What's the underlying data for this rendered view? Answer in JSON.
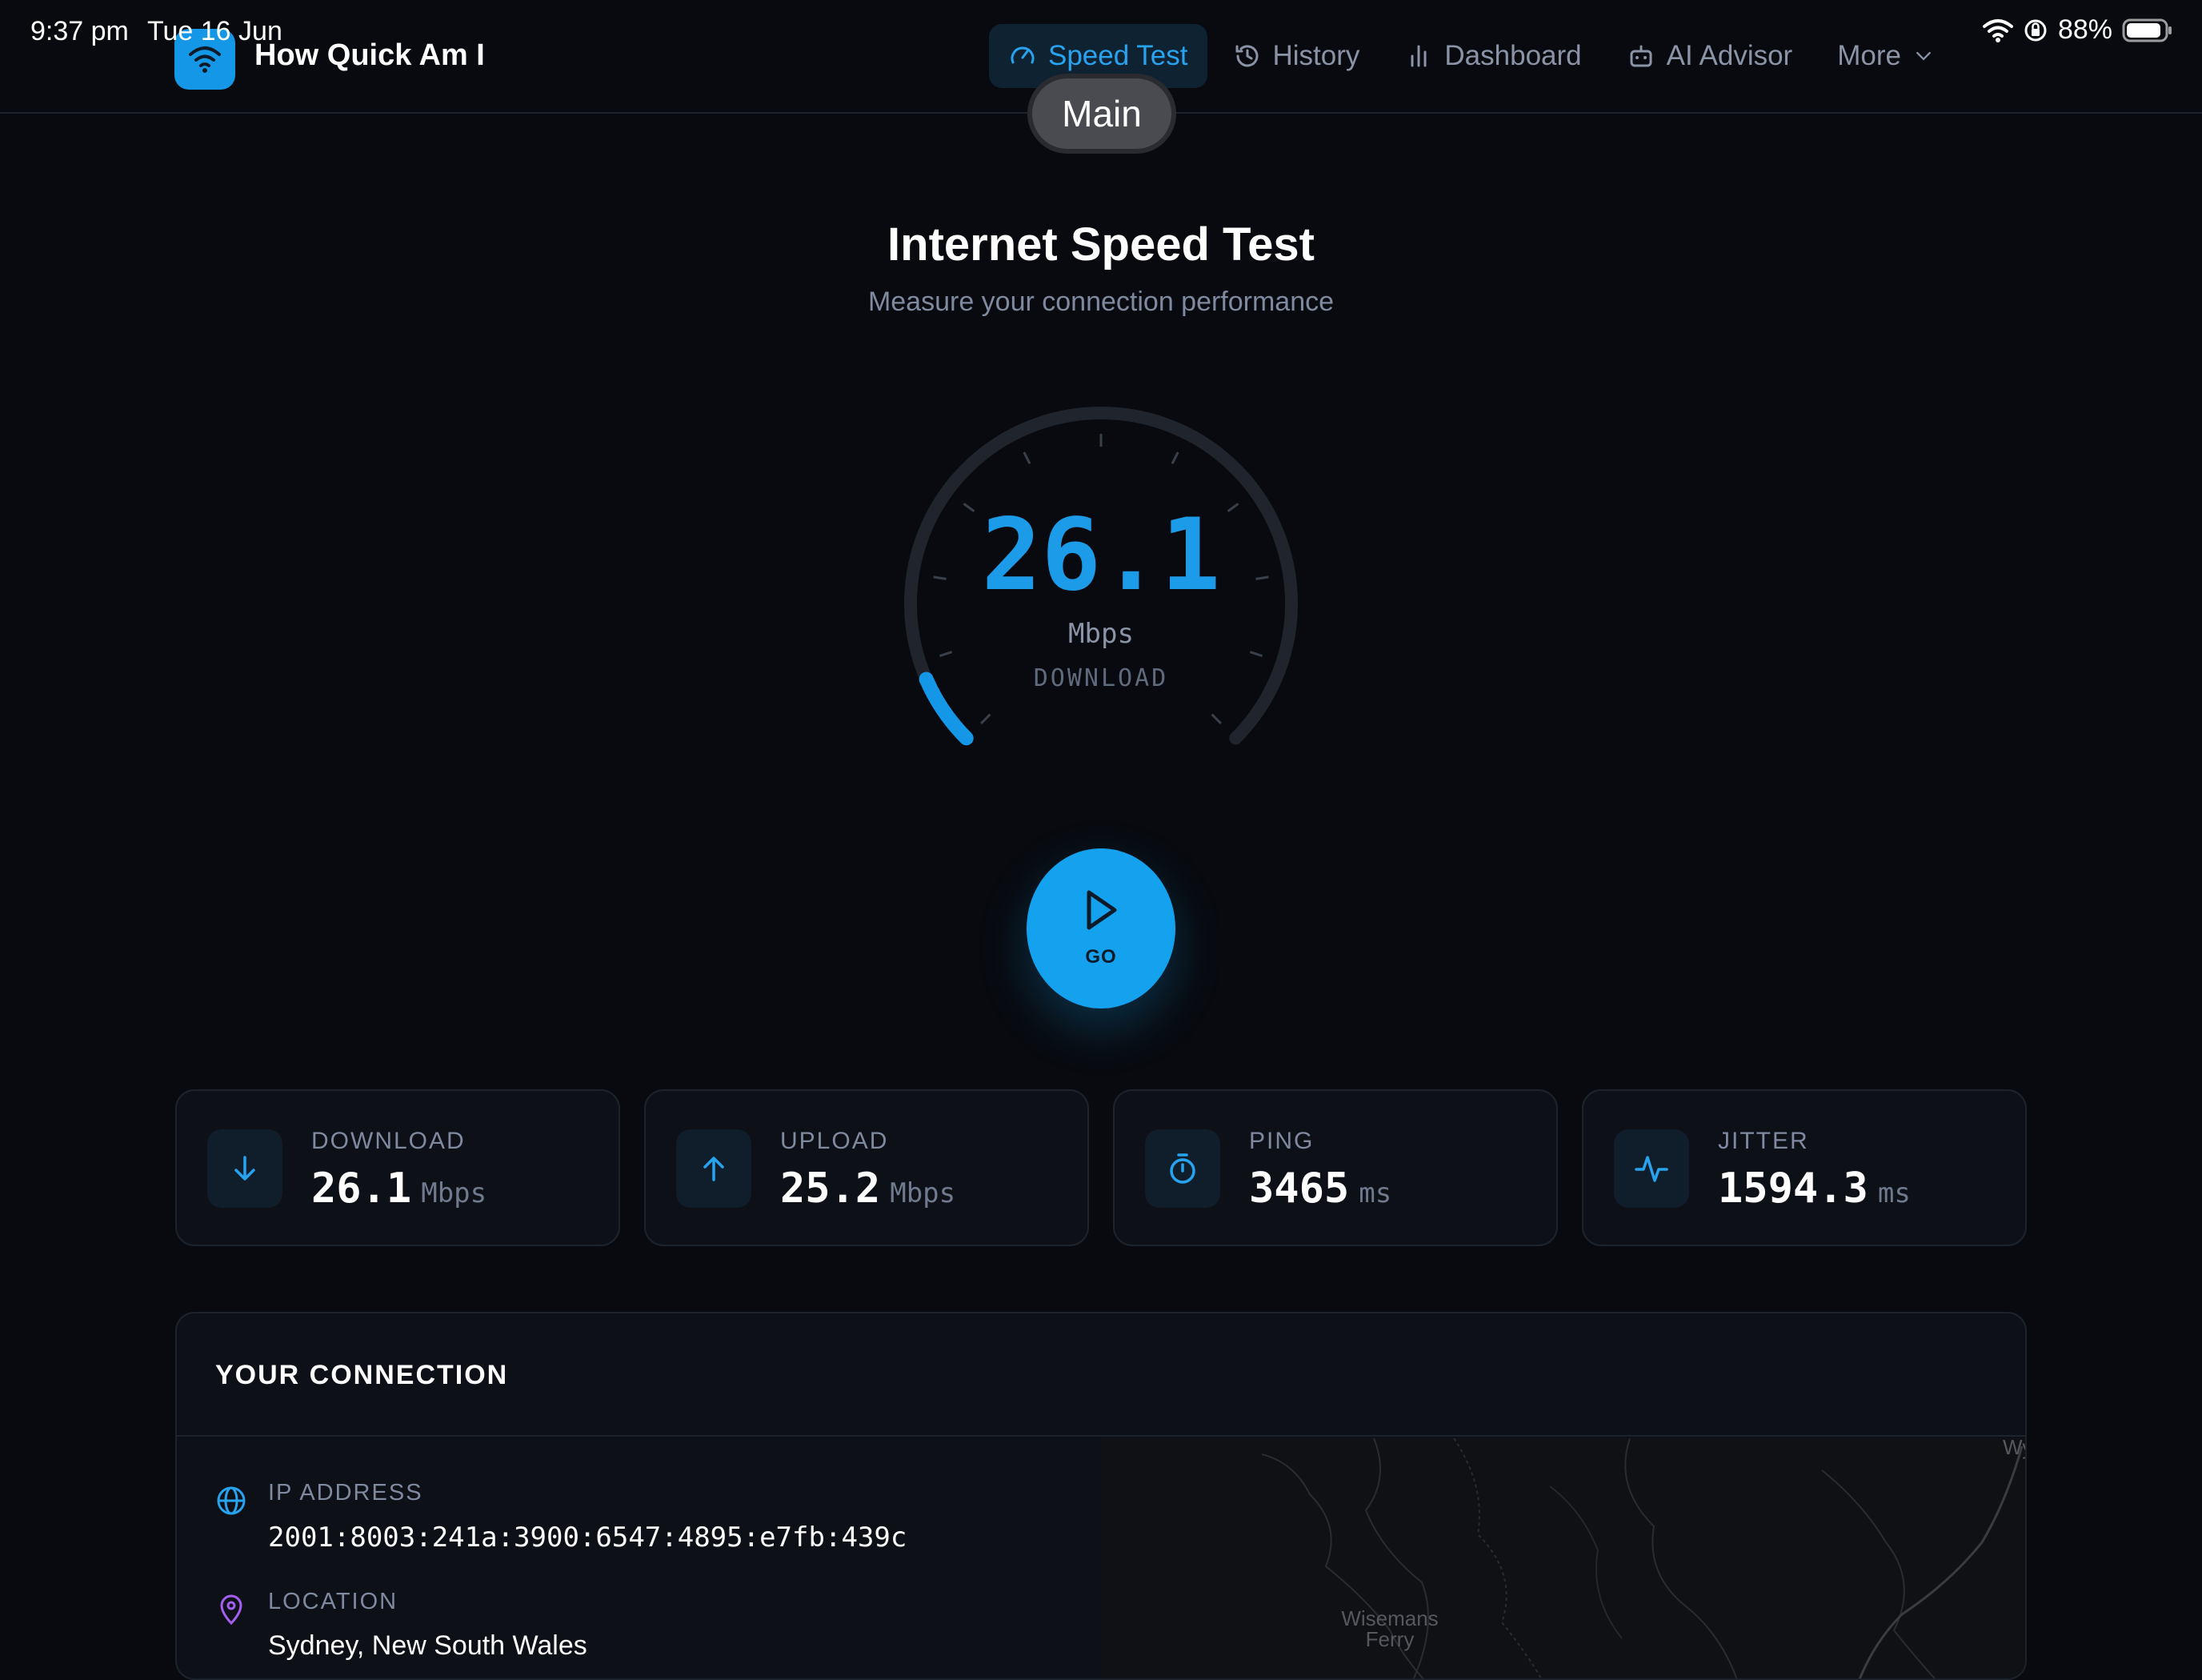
{
  "status_bar": {
    "time": "9:37 pm",
    "date": "Tue 16 Jun",
    "battery": "88%"
  },
  "app": {
    "title": "How Quick Am I",
    "accent": "#1497e6"
  },
  "nav": {
    "items": [
      {
        "label": "Speed Test",
        "icon": "gauge-icon",
        "active": true
      },
      {
        "label": "History",
        "icon": "history-icon"
      },
      {
        "label": "Dashboard",
        "icon": "bar-chart-icon"
      },
      {
        "label": "AI Advisor",
        "icon": "robot-icon"
      },
      {
        "label": "More",
        "icon": "chevron-down-icon"
      }
    ],
    "main_pill": "Main"
  },
  "hero": {
    "title": "Internet Speed Test",
    "subtitle": "Measure your connection performance"
  },
  "gauge": {
    "value": "26.1",
    "unit": "Mbps",
    "label": "DOWNLOAD",
    "fill_fraction": 0.08
  },
  "go_button": {
    "label": "GO"
  },
  "metrics": [
    {
      "label": "DOWNLOAD",
      "value": "26.1",
      "unit": "Mbps",
      "icon": "arrow-down-icon"
    },
    {
      "label": "UPLOAD",
      "value": "25.2",
      "unit": "Mbps",
      "icon": "arrow-up-icon"
    },
    {
      "label": "PING",
      "value": "3465",
      "unit": "ms",
      "icon": "stopwatch-icon"
    },
    {
      "label": "JITTER",
      "value": "1594.3",
      "unit": "ms",
      "icon": "activity-icon"
    }
  ],
  "connection": {
    "title": "YOUR CONNECTION",
    "ip_label": "IP ADDRESS",
    "ip_value": "2001:8003:241a:3900:6547:4895:e7fb:439c",
    "location_label": "LOCATION",
    "location_value": "Sydney, New South Wales",
    "map_labels": [
      "Wisemans",
      "Ferry",
      "Wy"
    ]
  }
}
